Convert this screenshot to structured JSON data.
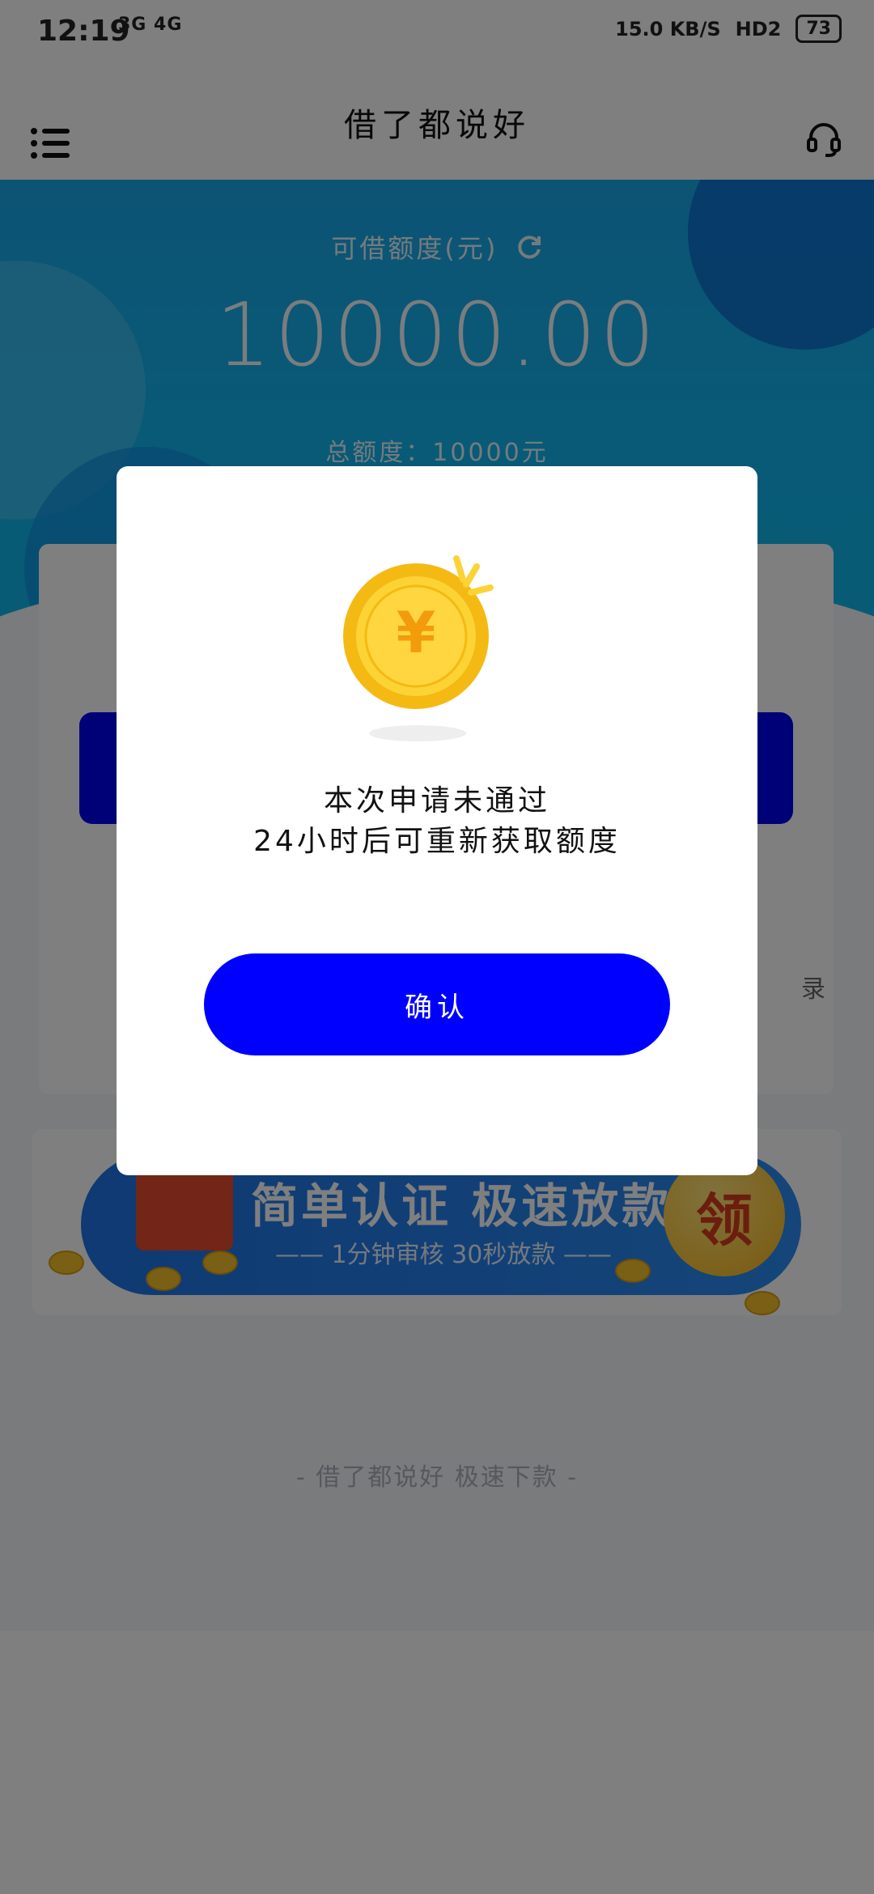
{
  "status_bar": {
    "time": "12:19",
    "network": "3G 4G",
    "speed": "15.0 KB/S",
    "hd": "HD2",
    "battery": "73"
  },
  "app_bar": {
    "title": "借了都说好",
    "menu_icon": "menu-list-icon",
    "service_icon": "headset-icon"
  },
  "hero": {
    "label": "可借额度(元)",
    "amount": "10000.00",
    "total": "总额度：10000元",
    "refresh_icon": "refresh-icon"
  },
  "card": {
    "records_label_partial": "录"
  },
  "banner": {
    "headline": "简单认证 极速放款",
    "subline": "—— 1分钟审核 30秒放款 ——",
    "badge": "领"
  },
  "footer": {
    "text": "- 借了都说好 极速下款 -"
  },
  "dialog": {
    "message_line1": "本次申请未通过",
    "message_line2": "24小时后可重新获取额度",
    "confirm_label": "确认",
    "icon": "yuan-coin-icon"
  },
  "colors": {
    "primary_blue": "#0000ff",
    "hero_blue": "#1aa6e9",
    "coin_gold": "#f7c51c"
  }
}
